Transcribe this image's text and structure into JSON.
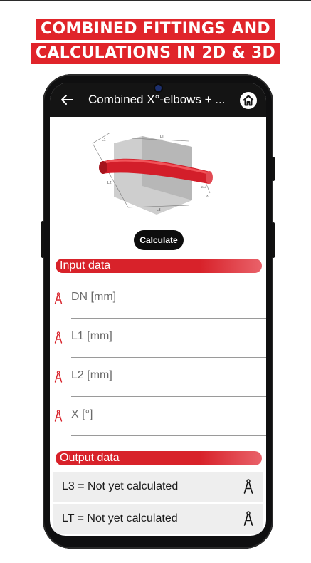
{
  "banner": {
    "line1": "COMBINED FITTINGS AND",
    "line2": "CALCULATIONS IN 2D & 3D"
  },
  "appbar": {
    "title": "Combined X°-elbows + ...",
    "back_icon": "arrow-left-icon",
    "home_icon": "home-icon"
  },
  "diagram": {
    "labels": {
      "l1": "L1",
      "lt": "LT",
      "l2": "L2",
      "l3": "L3",
      "dn": "DN",
      "x": "X°"
    }
  },
  "actions": {
    "calculate_label": "Calculate"
  },
  "input_section": {
    "title": "Input data",
    "fields": [
      {
        "label": "DN [mm]"
      },
      {
        "label": "L1 [mm]"
      },
      {
        "label": "L2 [mm]"
      },
      {
        "label": "X [°]"
      }
    ]
  },
  "output_section": {
    "title": "Output data",
    "results": [
      {
        "text": "L3 = Not yet calculated"
      },
      {
        "text": "LT = Not yet calculated"
      }
    ]
  },
  "colors": {
    "accent": "#d8222a",
    "appbar": "#141414",
    "compass_icon": "compass-icon"
  }
}
